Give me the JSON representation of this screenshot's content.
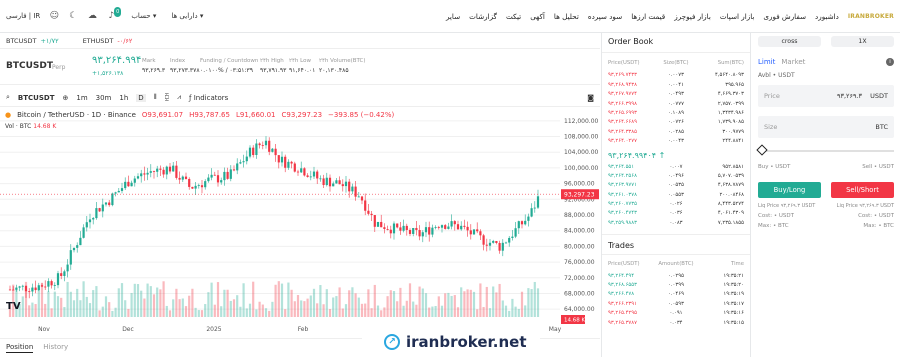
{
  "topbar": {
    "lang": "فارسی | IR",
    "markets": "دارایی ها",
    "account": "حساب",
    "nav": [
      "داشبورد",
      "سفارش فوری",
      "بازار اسپات",
      "بازار فیوچرز",
      "قیمت ارزها",
      "سود سپرده",
      "تحلیل ها",
      "آکهی",
      "تیکت",
      "گزارشات",
      "سایر"
    ],
    "logo": "IRANBROKER"
  },
  "pairs": [
    {
      "name": "BTCUSDT",
      "change": "+۱/۷۲",
      "color": "#22ab94"
    },
    {
      "name": "ETHUSDT",
      "change": "-۰/۶۲",
      "color": "#f23645"
    }
  ],
  "ticker": {
    "symbol": "BTCUSDT",
    "type": "Perp",
    "price": "۹۳,۲۶۴.۹۹۴",
    "price_sub": "+۱,۵۲۶.۱۳۸",
    "stats": [
      {
        "label": "Mark",
        "value": "۹۳,۲۶۹.۳"
      },
      {
        "label": "Index",
        "value": "۹۳,۲۷۳.۳۷۸"
      },
      {
        "label": "Funding / Countdown",
        "value": "۰.۰۱۰۰% / ۰۳:۵۱:۳۹"
      },
      {
        "label": "۲۴h High",
        "value": "۹۳,۷۹۱.۹۳"
      },
      {
        "label": "۲۴h Low",
        "value": "۹۱,۶۴۰.۰۱"
      },
      {
        "label": "۲۴h Volume(BTC)",
        "value": "۲۰,۱۳۰.۴۸۵"
      }
    ]
  },
  "toolbar": {
    "symbol": "BTCUSDT",
    "intervals": [
      "1m",
      "30m",
      "1h",
      "D"
    ],
    "indicators": "Indicators"
  },
  "chart_data": {
    "type": "candlestick",
    "title": "Bitcoin / TetherUSD · 1D · Binance",
    "ohlc": {
      "o": "93,691.07",
      "h": "93,787.65",
      "l": "91,660.01",
      "c": "93,297.23",
      "chg": "−393.85 (−0.42%)"
    },
    "volume_label": "Vol · BTC",
    "volume_value": "14.68 K",
    "last_price": "93,297.23",
    "y_ticks": [
      112000,
      108000,
      104000,
      100000,
      96000,
      92000,
      88000,
      84000,
      80000,
      76000,
      72000,
      68000,
      64000
    ],
    "x_ticks": [
      "Nov",
      "Dec",
      "2025",
      "Feb",
      "May"
    ],
    "ylim": [
      62000,
      114000
    ]
  },
  "bottom_tabs": [
    "Position",
    "History"
  ],
  "orderbook": {
    "title": "Order Book",
    "headers": [
      "Price(USDT)",
      "Size(BTC)",
      "Sum(BTC)"
    ],
    "asks": [
      [
        "۹۳,۲۶۹.۷۴۳۳",
        "۰.۰۰۷۳",
        "۴,۵۶۴۰.۸۰۹۳"
      ],
      [
        "۹۳,۲۶۸.۹۴۳۸",
        "۰.۰۰۴۱",
        "۳۹۵.۹۶۵"
      ],
      [
        "۹۳,۲۶۷.۹۷۷۴",
        "۰.۰۴۹۳",
        "۴,۶۶۹.۳۷۰۳"
      ],
      [
        "۹۳,۲۶۶.۳۹۹۸",
        "۰.۰۷۷۷",
        "۲,۷۵۷.۰۳۹۹"
      ],
      [
        "۹۳,۲۶۵.۶۹۹۳",
        "۰.۱۰۸۹",
        "۱,۳۴۳۴.۹۸۶"
      ],
      [
        "۹۳,۲۶۴.۶۶۸۹",
        "۰.۰۷۲۶",
        "۱,۷۳۹.۹۰۸۵"
      ],
      [
        "۹۳,۲۶۴.۳۳۸۵",
        "۰.۰۲۸۵",
        "۳۰۰.۹۷۷۹"
      ],
      [
        "۹۳,۲۶۴.۰۲۷۷",
        "۰.۰۰۴۳",
        "۲۴۴.۸۸۴۱"
      ]
    ],
    "mid": "۹۳,۲۶۴.۹۹۴۰۴",
    "bids": [
      [
        "۹۳,۲۶۴.۵۵۱",
        "۰.۰۰۷",
        "۹۵۲.۸۵۸۱"
      ],
      [
        "۹۳,۲۶۴.۲۵۶۸",
        "۰.۰۴۹۶",
        "۵,۷۰۷.۰۵۳۹"
      ],
      [
        "۹۳,۲۶۳.۹۷۷۱",
        "۰.۰۵۳۵",
        "۴,۶۳۸.۷۸۷۹"
      ],
      [
        "۹۳,۲۶۱.۰۳۷۸",
        "۰.۰۵۵۳",
        "۲۰۰.۰۸۴۶۸"
      ],
      [
        "۹۳,۲۶۰.۷۷۳۵",
        "۰.۰۲۶",
        "۸,۴۴۳.۵۲۷۴"
      ],
      [
        "۹۳,۲۶۰.۴۷۴۳",
        "۰.۰۳۶",
        "۴,۰۶۱.۴۳۰۹"
      ],
      [
        "۹۳,۲۵۹.۹۸۸۳",
        "۰.۰۸۳",
        "۷,۲۳۵.۱۸۵۵"
      ]
    ]
  },
  "trades": {
    "title": "Trades",
    "headers": [
      "Price(USDT)",
      "Amount(BTC)",
      "Time"
    ],
    "rows": [
      [
        "۹۳,۲۶۴.۴۹۴",
        "۰.۰۲۹۵",
        "۱۹:۳۵:۲۱",
        "#22ab94"
      ],
      [
        "۹۳,۲۶۸.۶۵۵۳",
        "۰.۰۳۹۹",
        "۱۹:۳۵:۲۰",
        "#22ab94"
      ],
      [
        "۹۳,۲۶۶.۴۷۸",
        "۰.۰۴۶۹",
        "۱۹:۳۵:۱۹",
        "#22ab94"
      ],
      [
        "۹۳,۲۶۶.۲۳۹۱",
        "۰.۰۵۹۳",
        "۱۹:۳۵:۱۷",
        "#f23645"
      ],
      [
        "۹۳,۲۶۵.۴۲۹۵",
        "۰.۰۹۱",
        "۱۹:۳۵:۱۶",
        "#f23645"
      ],
      [
        "۹۳,۲۶۵.۳۷۸۷",
        "۰.۰۳۴",
        "۱۹:۳۵:۱۵",
        "#f23645"
      ]
    ]
  },
  "panel": {
    "tabs": [
      "cross",
      "1X"
    ],
    "modes": [
      "Limit",
      "Market"
    ],
    "avbl": "Avbl • USDT",
    "price_label": "Price",
    "price_value": "۹۳,۲۶۹.۳",
    "price_unit": "USDT",
    "size_label": "Size",
    "size_unit": "BTC",
    "buy_small": "Buy • USDT",
    "sell_small": "Sell • USDT",
    "buy_btn": "Buy/Long",
    "sell_btn": "Sell/Short",
    "liq_buy": "Liq Price ۹۳,۲۶۹.۳ USDT",
    "liq_sell": "Liq Price ۹۳,۲۶۹.۳ USDT",
    "cost": "Cost: • USDT",
    "max": "Max: • BTC",
    "buy_color": "#22ab94",
    "sell_color": "#f23645"
  },
  "watermark": "iranbroker.net"
}
